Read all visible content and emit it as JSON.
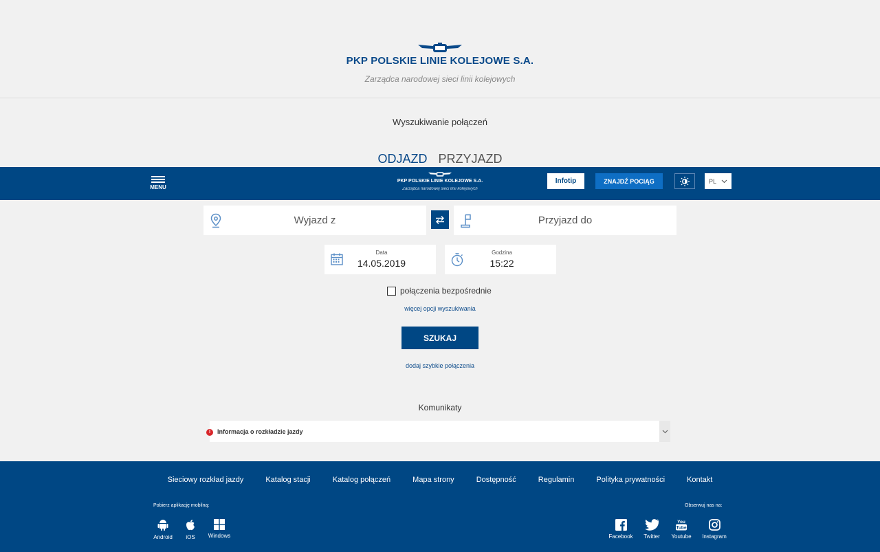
{
  "header": {
    "brand": "PKP POLSKIE LINIE KOLEJOWE S.A.",
    "tagline": "Zarządca narodowej sieci linii kolejowych"
  },
  "search": {
    "title": "Wyszukiwanie połączeń",
    "tabs": [
      "ODJAZD",
      "PRZYJAZD"
    ],
    "from_placeholder": "Wyjazd z",
    "to_placeholder": "Przyjazd do",
    "date_label": "Data",
    "date_value": "14.05.2019",
    "time_label": "Godzina",
    "time_value": "15:22",
    "direct_label": "połączenia bezpośrednie",
    "more_options": "więcej opcji wyszukiwania",
    "search_button": "SZUKAJ",
    "quick_add": "dodaj szybkie połączenia"
  },
  "navbar": {
    "menu_label": "MENU",
    "brand": "PKP POLSKIE LINIE KOLEJOWE S.A.",
    "tagline": "Zarządca narodowej sieci linii kolejowych",
    "infotip": "Infotip",
    "find_train": "ZNAJDŹ POCIĄG",
    "lang": "PL"
  },
  "notices": {
    "title": "Komunikaty",
    "items": [
      "Informacja o rozkładzie jazdy"
    ]
  },
  "footer": {
    "links": [
      "Sieciowy rozkład jazdy",
      "Katalog stacji",
      "Katalog połączeń",
      "Mapa strony",
      "Dostępność",
      "Regulamin",
      "Polityka prywatności",
      "Kontakt"
    ],
    "apps_title": "Pobierz aplikację mobilną:",
    "apps": [
      "Android",
      "iOS",
      "Windows"
    ],
    "follow_title": "Obserwuj nas na:",
    "social": [
      "Facebook",
      "Twitter",
      "Youtube",
      "Instagram"
    ]
  },
  "colors": {
    "primary": "#004784",
    "accent": "#0e6ec4",
    "alert": "#d8262a"
  }
}
